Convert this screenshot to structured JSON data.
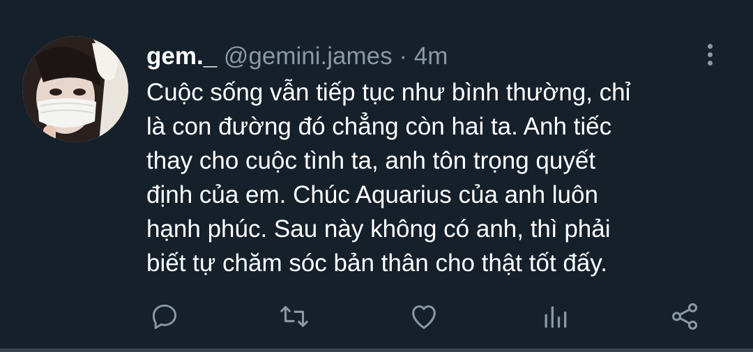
{
  "tweet": {
    "display_name": "gem._",
    "handle": "@gemini.james",
    "separator": "·",
    "time": "4m",
    "text_lines": [
      "Cuộc sống vẫn tiếp tục như bình thường, chỉ",
      "là con đường đó chẳng còn hai ta. Anh tiếc",
      "thay cho cuộc tình ta, anh tôn trọng quyết",
      "định của em. Chúc Aquarius của anh luôn",
      "hạnh phúc. Sau này không có anh, thì phải",
      "biết tự chăm sóc bản thân cho thật tốt đấy."
    ]
  },
  "icons": {
    "more": "more-vertical-icon",
    "reply": "reply-icon",
    "retweet": "retweet-icon",
    "like": "heart-icon",
    "analytics": "analytics-icon",
    "share": "share-icon"
  },
  "colors": {
    "background": "#15202b",
    "text": "#ffffff",
    "secondary": "#8b98a5"
  }
}
